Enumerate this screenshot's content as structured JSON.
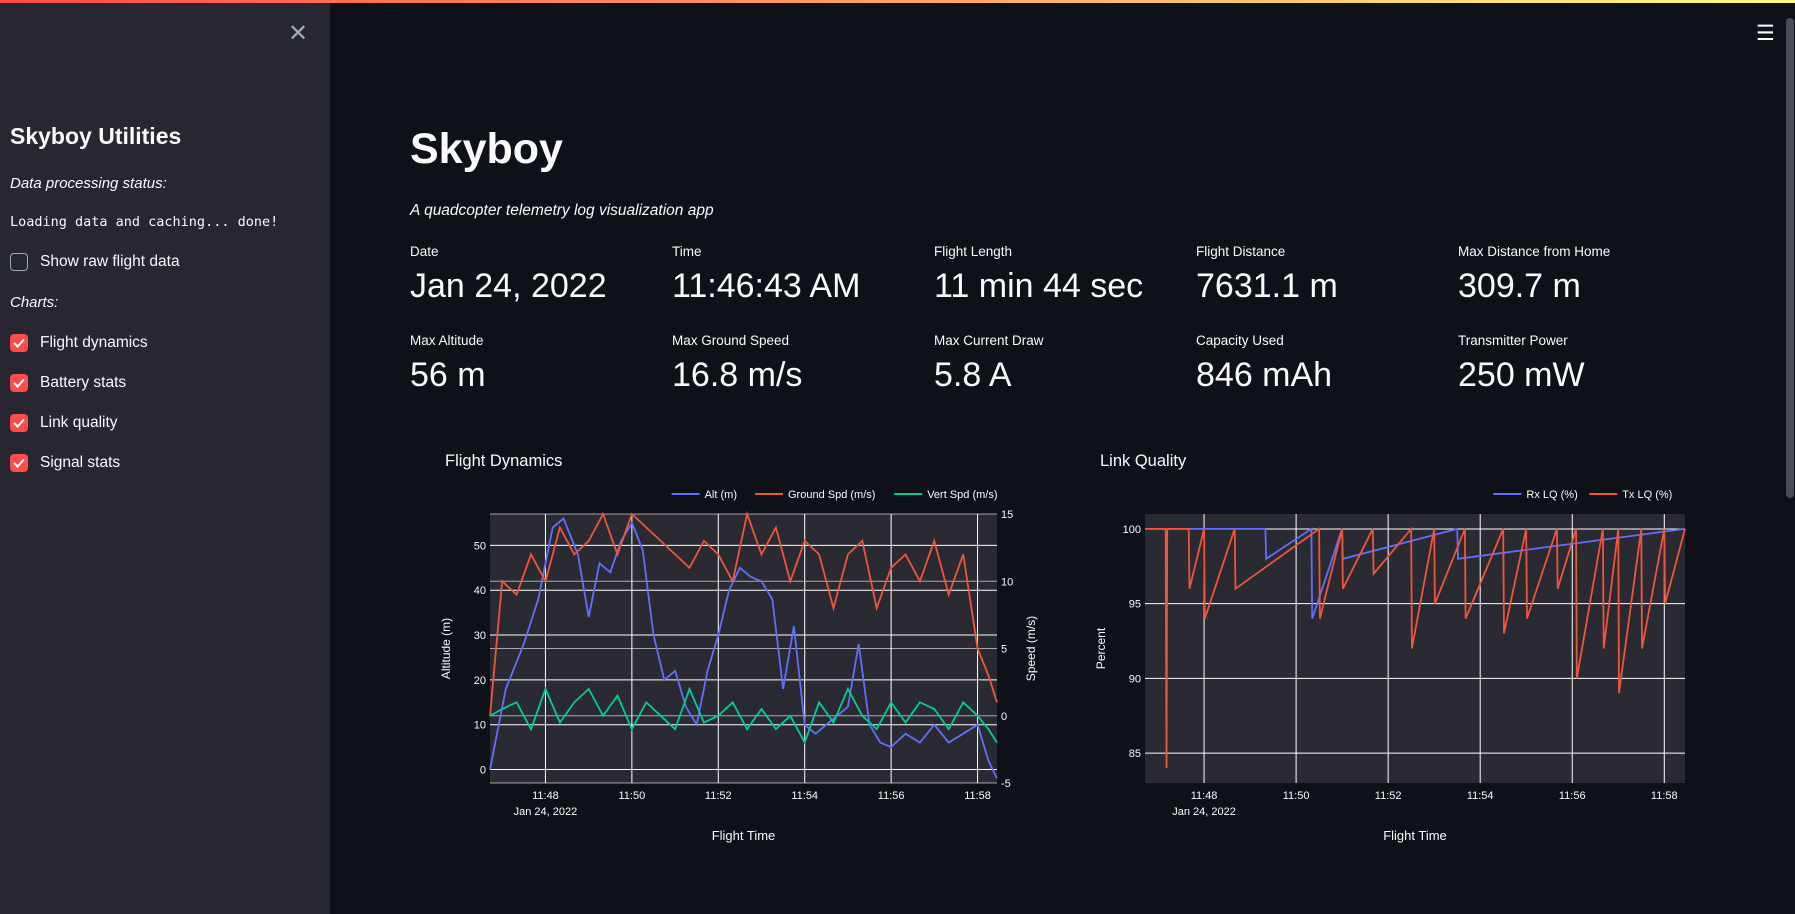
{
  "sidebar": {
    "close_icon": "close-icon",
    "title": "Skyboy Utilities",
    "status_label": "Data processing status:",
    "status_text": "Loading data and caching... done!",
    "show_raw_label": "Show raw flight data",
    "show_raw_checked": false,
    "charts_label": "Charts:",
    "chart_options": [
      {
        "label": "Flight dynamics",
        "checked": true
      },
      {
        "label": "Battery stats",
        "checked": true
      },
      {
        "label": "Link quality",
        "checked": true
      },
      {
        "label": "Signal stats",
        "checked": true
      }
    ]
  },
  "header": {
    "menu_icon": "hamburger-menu-icon"
  },
  "main": {
    "title": "Skyboy",
    "subtitle": "A quadcopter telemetry log visualization app",
    "metrics": [
      {
        "label": "Date",
        "value": "Jan 24, 2022"
      },
      {
        "label": "Time",
        "value": "11:46:43 AM"
      },
      {
        "label": "Flight Length",
        "value": "11 min 44 sec"
      },
      {
        "label": "Flight Distance",
        "value": "7631.1 m"
      },
      {
        "label": "Max Distance from Home",
        "value": "309.7 m"
      },
      {
        "label": "Max Altitude",
        "value": "56 m"
      },
      {
        "label": "Max Ground Speed",
        "value": "16.8 m/s"
      },
      {
        "label": "Max Current Draw",
        "value": "5.8 A"
      },
      {
        "label": "Capacity Used",
        "value": "846 mAh"
      },
      {
        "label": "Transmitter Power",
        "value": "250 mW"
      }
    ]
  },
  "colors": {
    "accent": "#ff4b4b",
    "alt": "#636efa",
    "ground": "#ef553b",
    "vert": "#00cc96",
    "plot_bg": "#2a2a33",
    "page_bg": "#0e1117"
  },
  "chart_data": [
    {
      "type": "line",
      "title": "Flight Dynamics",
      "xlabel": "Flight Time",
      "ylabel": "Altitude (m)",
      "y2label": "Speed (m/s)",
      "x_range": [
        "11:46:43",
        "11:58:27"
      ],
      "x_ticks": [
        "11:48",
        "11:50",
        "11:52",
        "11:54",
        "11:56",
        "11:58"
      ],
      "x_date_label": "Jan 24, 2022",
      "ylim": [
        -3,
        57
      ],
      "y_ticks": [
        0,
        10,
        20,
        30,
        40,
        50
      ],
      "y2lim": [
        -5,
        15
      ],
      "y2_ticks": [
        -5,
        0,
        5,
        10,
        15
      ],
      "grid": true,
      "legend_position": "top-right",
      "series": [
        {
          "name": "Alt (m)",
          "axis": "y",
          "color": "#636efa",
          "x": [
            "11:46:43",
            "11:47:05",
            "11:47:30",
            "11:47:50",
            "11:48:10",
            "11:48:25",
            "11:48:45",
            "11:49:00",
            "11:49:15",
            "11:49:30",
            "11:49:45",
            "11:50:00",
            "11:50:15",
            "11:50:30",
            "11:50:45",
            "11:51:00",
            "11:51:15",
            "11:51:30",
            "11:51:45",
            "11:52:00",
            "11:52:15",
            "11:52:30",
            "11:52:45",
            "11:53:00",
            "11:53:15",
            "11:53:30",
            "11:53:45",
            "11:54:00",
            "11:54:15",
            "11:54:30",
            "11:54:45",
            "11:55:00",
            "11:55:15",
            "11:55:30",
            "11:55:45",
            "11:56:00",
            "11:56:20",
            "11:56:40",
            "11:57:00",
            "11:57:20",
            "11:57:40",
            "11:58:00",
            "11:58:15",
            "11:58:27"
          ],
          "y": [
            0,
            18,
            28,
            38,
            54,
            56,
            48,
            34,
            46,
            44,
            51,
            55,
            49,
            30,
            20,
            22,
            14,
            10,
            22,
            30,
            40,
            45,
            43,
            42,
            38,
            18,
            32,
            10,
            8,
            10,
            12,
            14,
            28,
            10,
            6,
            5,
            8,
            6,
            10,
            6,
            8,
            10,
            2,
            -2
          ]
        },
        {
          "name": "Ground Spd (m/s)",
          "axis": "y2",
          "color": "#ef553b",
          "x": [
            "11:46:43",
            "11:47:00",
            "11:47:20",
            "11:47:40",
            "11:48:00",
            "11:48:20",
            "11:48:40",
            "11:49:00",
            "11:49:20",
            "11:49:40",
            "11:50:00",
            "11:50:20",
            "11:50:40",
            "11:51:00",
            "11:51:20",
            "11:51:40",
            "11:52:00",
            "11:52:20",
            "11:52:40",
            "11:53:00",
            "11:53:20",
            "11:53:40",
            "11:54:00",
            "11:54:20",
            "11:54:40",
            "11:55:00",
            "11:55:20",
            "11:55:40",
            "11:56:00",
            "11:56:20",
            "11:56:40",
            "11:57:00",
            "11:57:20",
            "11:57:40",
            "11:58:00",
            "11:58:15",
            "11:58:27"
          ],
          "y": [
            0,
            10,
            9,
            12,
            10,
            14,
            12,
            13,
            15,
            12,
            15,
            14,
            13,
            12,
            11,
            13,
            12,
            10,
            15,
            12,
            14,
            10,
            13,
            12,
            8,
            12,
            13,
            8,
            11,
            12,
            10,
            13,
            9,
            12,
            5,
            3,
            1
          ]
        },
        {
          "name": "Vert Spd (m/s)",
          "axis": "y2",
          "color": "#00cc96",
          "x": [
            "11:46:43",
            "11:47:00",
            "11:47:20",
            "11:47:40",
            "11:48:00",
            "11:48:20",
            "11:48:40",
            "11:49:00",
            "11:49:20",
            "11:49:40",
            "11:50:00",
            "11:50:20",
            "11:50:40",
            "11:51:00",
            "11:51:20",
            "11:51:40",
            "11:52:00",
            "11:52:20",
            "11:52:40",
            "11:53:00",
            "11:53:20",
            "11:53:40",
            "11:54:00",
            "11:54:20",
            "11:54:40",
            "11:55:00",
            "11:55:20",
            "11:55:40",
            "11:56:00",
            "11:56:20",
            "11:56:40",
            "11:57:00",
            "11:57:20",
            "11:57:40",
            "11:58:00",
            "11:58:15",
            "11:58:27"
          ],
          "y": [
            0,
            0.5,
            1,
            -1,
            2,
            -0.5,
            1,
            2,
            0,
            1.5,
            -1,
            1,
            0,
            -1,
            2,
            -0.5,
            0,
            1,
            -1,
            0.5,
            -1,
            0,
            -2,
            1,
            -0.5,
            2,
            0,
            -1,
            1,
            -0.5,
            1,
            0.5,
            -1,
            1,
            0,
            -1,
            -2
          ]
        }
      ]
    },
    {
      "type": "line",
      "title": "Link Quality",
      "xlabel": "Flight Time",
      "ylabel": "Percent",
      "x_range": [
        "11:46:43",
        "11:58:27"
      ],
      "x_ticks": [
        "11:48",
        "11:50",
        "11:52",
        "11:54",
        "11:56",
        "11:58"
      ],
      "x_date_label": "Jan 24, 2022",
      "ylim": [
        83,
        101
      ],
      "y_ticks": [
        85,
        90,
        95,
        100
      ],
      "grid": true,
      "legend_position": "top-right",
      "series": [
        {
          "name": "Rx LQ (%)",
          "color": "#636efa",
          "x": [
            "11:46:43",
            "11:48:00",
            "11:49:20",
            "11:49:21",
            "11:50:20",
            "11:50:21",
            "11:51:00",
            "11:51:01",
            "11:53:30",
            "11:53:31",
            "11:58:27"
          ],
          "y": [
            100,
            100,
            100,
            98,
            100,
            94,
            100,
            98,
            100,
            98,
            100
          ]
        },
        {
          "name": "Tx LQ (%)",
          "color": "#ef553b",
          "x": [
            "11:46:43",
            "11:47:10",
            "11:47:11",
            "11:47:12",
            "11:47:40",
            "11:47:41",
            "11:48:00",
            "11:48:01",
            "11:48:40",
            "11:48:41",
            "11:50:30",
            "11:50:31",
            "11:51:00",
            "11:51:01",
            "11:51:40",
            "11:51:41",
            "11:52:30",
            "11:52:31",
            "11:53:00",
            "11:53:01",
            "11:53:40",
            "11:53:41",
            "11:54:30",
            "11:54:31",
            "11:55:00",
            "11:55:01",
            "11:55:40",
            "11:55:41",
            "11:56:05",
            "11:56:06",
            "11:56:40",
            "11:56:41",
            "11:57:00",
            "11:57:01",
            "11:57:30",
            "11:57:31",
            "11:58:00",
            "11:58:01",
            "11:58:27"
          ],
          "y": [
            100,
            100,
            84,
            100,
            100,
            96,
            100,
            94,
            100,
            96,
            100,
            94,
            100,
            96,
            100,
            97,
            100,
            92,
            100,
            95,
            100,
            94,
            100,
            93,
            100,
            94,
            100,
            96,
            100,
            90,
            100,
            92,
            100,
            89,
            100,
            92,
            100,
            95,
            100
          ]
        }
      ]
    }
  ]
}
